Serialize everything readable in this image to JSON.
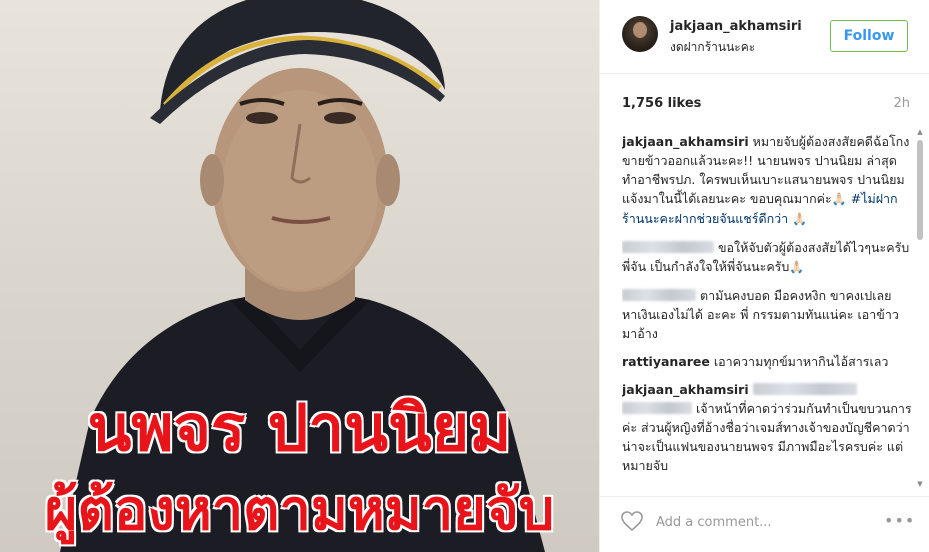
{
  "photo": {
    "caption_line1": "นพจร ปานนิยม",
    "caption_line2": "ผู้ต้องหาตามหมายจับ",
    "caption_color": "#e8141a"
  },
  "header": {
    "username": "jakjaan_akhamsiri",
    "location": "งดฝากร้านนะคะ",
    "follow_label": "Follow"
  },
  "stats": {
    "likes": "1,756 likes",
    "time": "2h"
  },
  "comments": [
    {
      "user": "jakjaan_akhamsiri",
      "text": "หมายจับผู้ต้องสงสัยคดีฉ้อโกงขายข้าวออกแล้วนะคะ!! นายนพจร ปานนิยม ล่าสุดทำอาชีพรปภ. ใครพบเห็นเบาะแสนายนพจร ปานนิยม แจ้งมาในนี้ได้เลยนะคะ ขอบคุณมากค่ะ",
      "emoji1": "🙏🏻",
      "hashtag": "#ไม่ฝากร้านนะคะฝากช่วยจันแชร์ดีกว่า",
      "emoji2": "🙏🏻"
    },
    {
      "user": "",
      "text": "ขอให้จับตัวผู้ต้องสงสัยได้ไวๆนะครับพี่จัน เป็นกำลังใจให้พี่จันนะครับ",
      "emoji": "🙏🏻"
    },
    {
      "user": "",
      "text": "ตามันคงบอด มือคงหงิก ขาคงเปเลยหาเงินเองไม่ได้ อะคะ พี่ กรรมตามทันแน่คะ เอาข้าว มาอ้าง"
    },
    {
      "user": "rattiyanaree",
      "text": "เอาความทุกข์มาหากินไอ้สารเลว"
    },
    {
      "user": "jakjaan_akhamsiri",
      "text": "เจ้าหน้าที่คาดว่าร่วมกันทำเป็นขบวนการค่ะ ส่วนผู้หญิงที่อ้างชื่อว่าเจมส์ทางเจ้าของบัญชีคาดว่าน่าจะเป็นแฟนของนายนพจร มีภาพมือะไรครบค่ะ แต่หมายจับ"
    }
  ],
  "footer": {
    "comment_placeholder": "Add a comment...",
    "more_label": "•••"
  },
  "colors": {
    "follow_border": "#70c050",
    "follow_text": "#3897f0",
    "hashtag": "#003569"
  }
}
